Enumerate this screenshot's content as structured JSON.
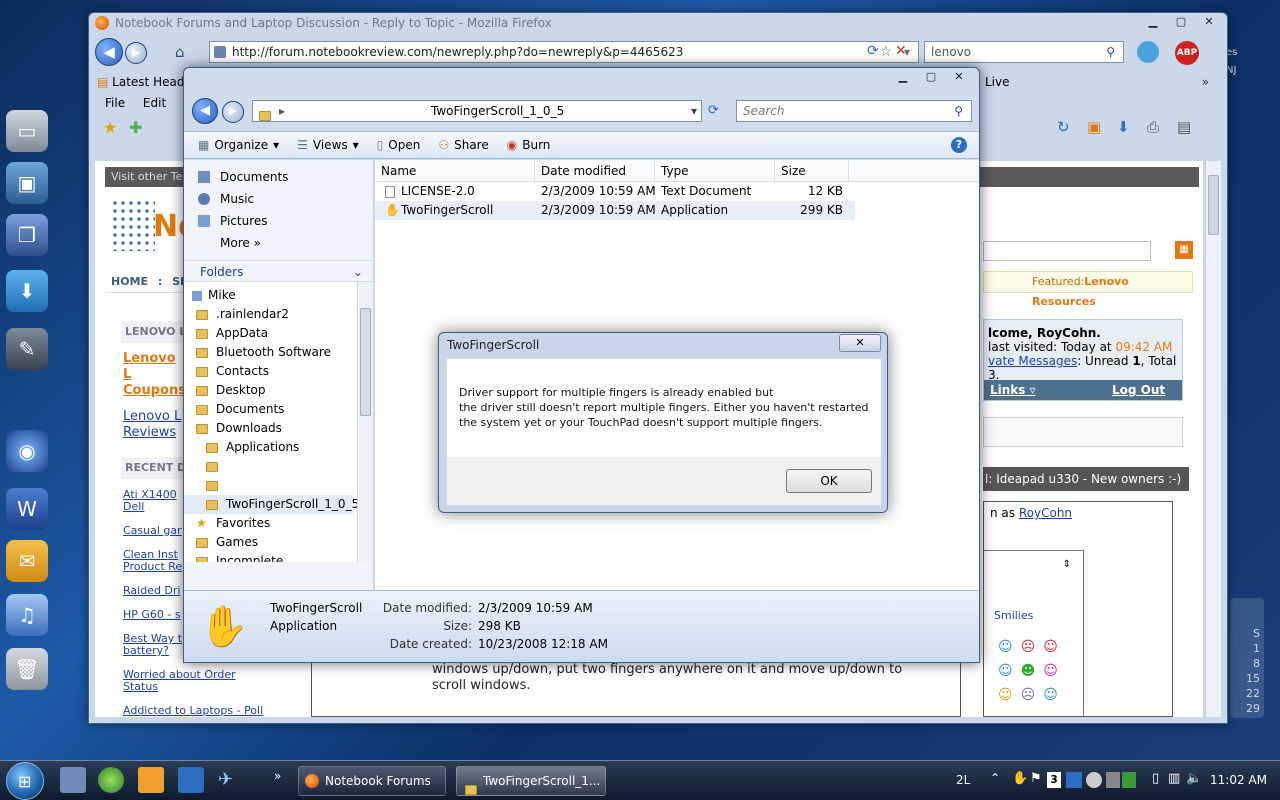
{
  "firefox": {
    "title": "Notebook Forums and Laptop Discussion - Reply to Topic - Mozilla Firefox",
    "url": "http://forum.notebookreview.com/newreply.php?do=newreply&p=4465623",
    "search_value": "lenovo",
    "bookmarks": {
      "latest_headlines": "Latest Headl",
      "live": "Live"
    },
    "menu": {
      "file": "File",
      "edit": "Edit",
      "view": "Vi"
    }
  },
  "forum": {
    "visit_other": "Visit other Te",
    "logo_partial": "No",
    "nav": {
      "home": "HOME",
      "sep": ":",
      "sh": "SH"
    },
    "featured_label": "Featured:",
    "featured_value": "Lenovo Resources",
    "sidebar_lenovo_title": "LENOVO L",
    "lenovo_links": [
      "Lenovo L Coupons",
      "Lenovo L Reviews"
    ],
    "recent_title": "RECENT D",
    "recent_links": [
      "Ati X1400 Dell",
      "Casual gar",
      "Clean Inst Product Re",
      "Raided Dri",
      "HP G60 - s",
      "Best Way t battery?",
      "Worried about Order Status",
      "Addicted to Laptops - Poll"
    ],
    "welcome": "lcome, RoyCohn.",
    "last_visited_label": "last visited: Today at",
    "last_visited_time": "09:42 AM",
    "pm_link": "vate Messages",
    "pm_unread_label": ": Unread",
    "pm_unread": "1",
    "pm_total_label": ", Total",
    "pm_total": "3.",
    "links_label": "Links",
    "logout": "Log Out",
    "thread_title": "l: Ideapad u330 - New owners :-)",
    "logged_in_as": "n as",
    "username": "RoyCohn",
    "smilies_label": "Smilies",
    "post_text_1": "windows up/down, put two fingers anywhere on it and move up/down to",
    "post_text_2": "scroll windows."
  },
  "explorer": {
    "path": "TwoFingerScroll_1_0_5",
    "search_placeholder": "Search",
    "commands": {
      "organize": "Organize",
      "views": "Views",
      "open": "Open",
      "share": "Share",
      "burn": "Burn"
    },
    "favorite_links": [
      "Documents",
      "Music",
      "Pictures",
      "More"
    ],
    "folders_label": "Folders",
    "tree": [
      "Mike",
      ".rainlendar2",
      "AppData",
      "Bluetooth Software",
      "Contacts",
      "Desktop",
      "Documents",
      "Downloads",
      "Applications",
      "",
      "",
      "TwoFingerScroll_1_0_5",
      "Favorites",
      "Games",
      "Incomplete"
    ],
    "columns": {
      "name": "Name",
      "date": "Date modified",
      "type": "Type",
      "size": "Size"
    },
    "files": [
      {
        "name": "LICENSE-2.0",
        "date": "2/3/2009 10:59 AM",
        "type": "Text Document",
        "size": "12 KB"
      },
      {
        "name": "TwoFingerScroll",
        "date": "2/3/2009 10:59 AM",
        "type": "Application",
        "size": "299 KB"
      }
    ],
    "details": {
      "name": "TwoFingerScroll",
      "type": "Application",
      "date_modified_label": "Date modified:",
      "date_modified": "2/3/2009 10:59 AM",
      "size_label": "Size:",
      "size": "298 KB",
      "date_created_label": "Date created:",
      "date_created": "10/23/2008 12:18 AM"
    }
  },
  "dialog": {
    "title": "TwoFingerScroll",
    "line1": "Driver support for multiple fingers is already enabled but",
    "line2": "the driver still doesn't report multiple fingers. Either you haven't restarted",
    "line3": "the system yet or your TouchPad doesn't support multiple fingers.",
    "ok": "OK"
  },
  "taskbar": {
    "firefox_task": "Notebook Forums ...",
    "explorer_task": "TwoFingerScroll_1...",
    "lang": "2L",
    "tray_num": "3",
    "clock": "11:02 AM"
  },
  "calendar_gadget": {
    "letter": "S",
    "numbers": [
      "1",
      "8",
      "15",
      "22",
      "29"
    ]
  },
  "gadget_top_text": [
    "es",
    "NJ"
  ],
  "colors": {
    "accent_orange": "#e07a10",
    "link_blue": "#1c3fb0",
    "forum_bar": "#555555"
  }
}
